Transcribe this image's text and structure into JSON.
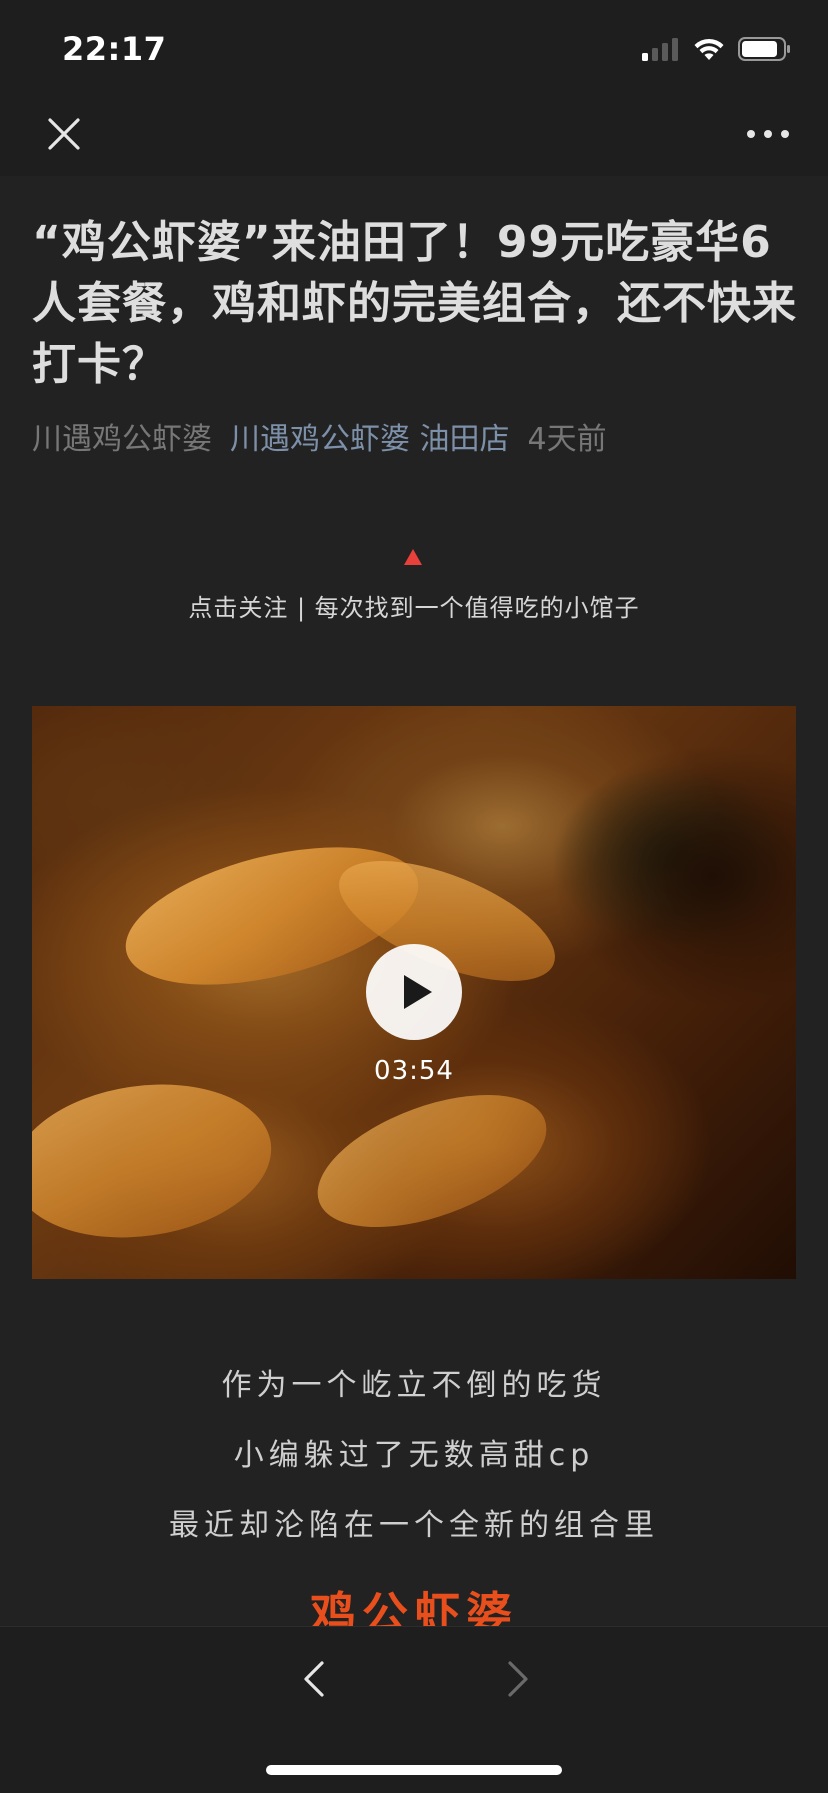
{
  "status_bar": {
    "time": "22:17"
  },
  "nav": {
    "close_icon": "close-icon",
    "more_icon": "more-icon"
  },
  "article": {
    "title": "“鸡公虾婆”来油田了！99元吃豪华6人套餐，鸡和虾的完美组合，还不快来打卡？",
    "author": "川遇鸡公虾婆",
    "account_name": "川遇鸡公虾婆 油田店",
    "publish_time": "4天前",
    "follow_text": "点击关注 | 每次找到一个值得吃的小馆子",
    "video": {
      "duration": "03:54"
    },
    "body_lines": [
      "作为一个屹立不倒的吃货",
      "小编躲过了无数高甜cp",
      "最近却沦陷在一个全新的组合里"
    ],
    "highlight": "鸡公虾婆"
  },
  "toolbar": {
    "back_icon": "chevron-left-icon",
    "forward_icon": "chevron-right-icon"
  },
  "colors": {
    "background": "#222222",
    "bars": "#1e1e1e",
    "account_link": "#7d90a9",
    "highlight": "#e84f1c",
    "follow_arrow": "#e8403b"
  }
}
